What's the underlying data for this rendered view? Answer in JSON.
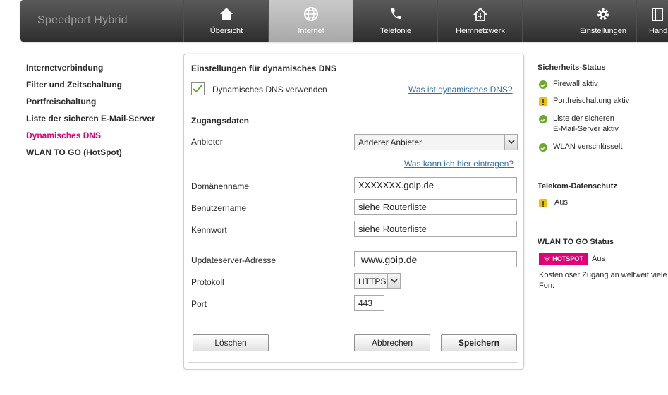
{
  "header": {
    "brand": "Speedport Hybrid",
    "nav": [
      {
        "label": "Übersicht",
        "icon": "home-icon"
      },
      {
        "label": "Internet",
        "icon": "globe-icon"
      },
      {
        "label": "Telefonie",
        "icon": "phone-icon"
      },
      {
        "label": "Heimnetzwerk",
        "icon": "house-network-icon"
      },
      {
        "label": "Einstellungen",
        "icon": "gear-icon"
      },
      {
        "label": "Handb",
        "icon": "book-icon"
      }
    ],
    "active_nav": "Internet"
  },
  "sidebar": {
    "items": [
      {
        "label": "Internetverbindung"
      },
      {
        "label": "Filter und Zeitschaltung"
      },
      {
        "label": "Portfreischaltung"
      },
      {
        "label": "Liste der sicheren E-Mail-Server"
      },
      {
        "label": "Dynamisches DNS"
      },
      {
        "label": "WLAN TO GO (HotSpot)"
      }
    ],
    "active": "Dynamisches DNS"
  },
  "form": {
    "section_title": "Einstellungen für dynamisches DNS",
    "use_ddns_label": "Dynamisches DNS verwenden",
    "use_ddns_checked": true,
    "what_is_link": "Was ist dynamisches DNS?",
    "credentials_title": "Zugangsdaten",
    "provider_label": "Anbieter",
    "provider_value": "Anderer Anbieter",
    "what_to_enter_link": "Was kann ich hier eintragen?",
    "domain_label": "Domänenname",
    "domain_value": "XXXXXXX.goip.de",
    "username_label": "Benutzername",
    "username_value": "siehe Routerliste",
    "password_label": "Kennwort",
    "password_value": "siehe Routerliste",
    "update_server_label": "Updateserver-Adresse",
    "update_server_value": " www.goip.de",
    "protocol_label": "Protokoll",
    "protocol_value": "HTTPS",
    "port_label": "Port",
    "port_value": "443",
    "delete_button": "Löschen",
    "cancel_button": "Abbrechen",
    "save_button": "Speichern"
  },
  "status": {
    "security_title": "Sicherheits-Status",
    "security_items": [
      {
        "text": "Firewall aktiv",
        "state": "ok"
      },
      {
        "text": "Portfreischaltung aktiv",
        "state": "warning"
      },
      {
        "text": "Liste der sicheren",
        "text2": "E-Mail-Server aktiv",
        "state": "ok"
      },
      {
        "text": "WLAN verschlüsselt",
        "state": "ok"
      }
    ],
    "privacy_title": "Telekom-Datenschutz",
    "privacy_value": "Aus",
    "hotspot_title": "WLAN TO GO Status",
    "hotspot_badge": "HOTSPOT",
    "hotspot_state": "Aus",
    "hotspot_desc_line1": "Kostenloser Zugang an weltweit viele",
    "hotspot_desc_line2": "Fon."
  },
  "colors": {
    "accent": "#e20074",
    "link": "#2e6fb2",
    "ok": "#6aab2e",
    "warning": "#f2c200",
    "nav_bg": "#3a3a3a",
    "nav_active": "#b8b8b8"
  }
}
